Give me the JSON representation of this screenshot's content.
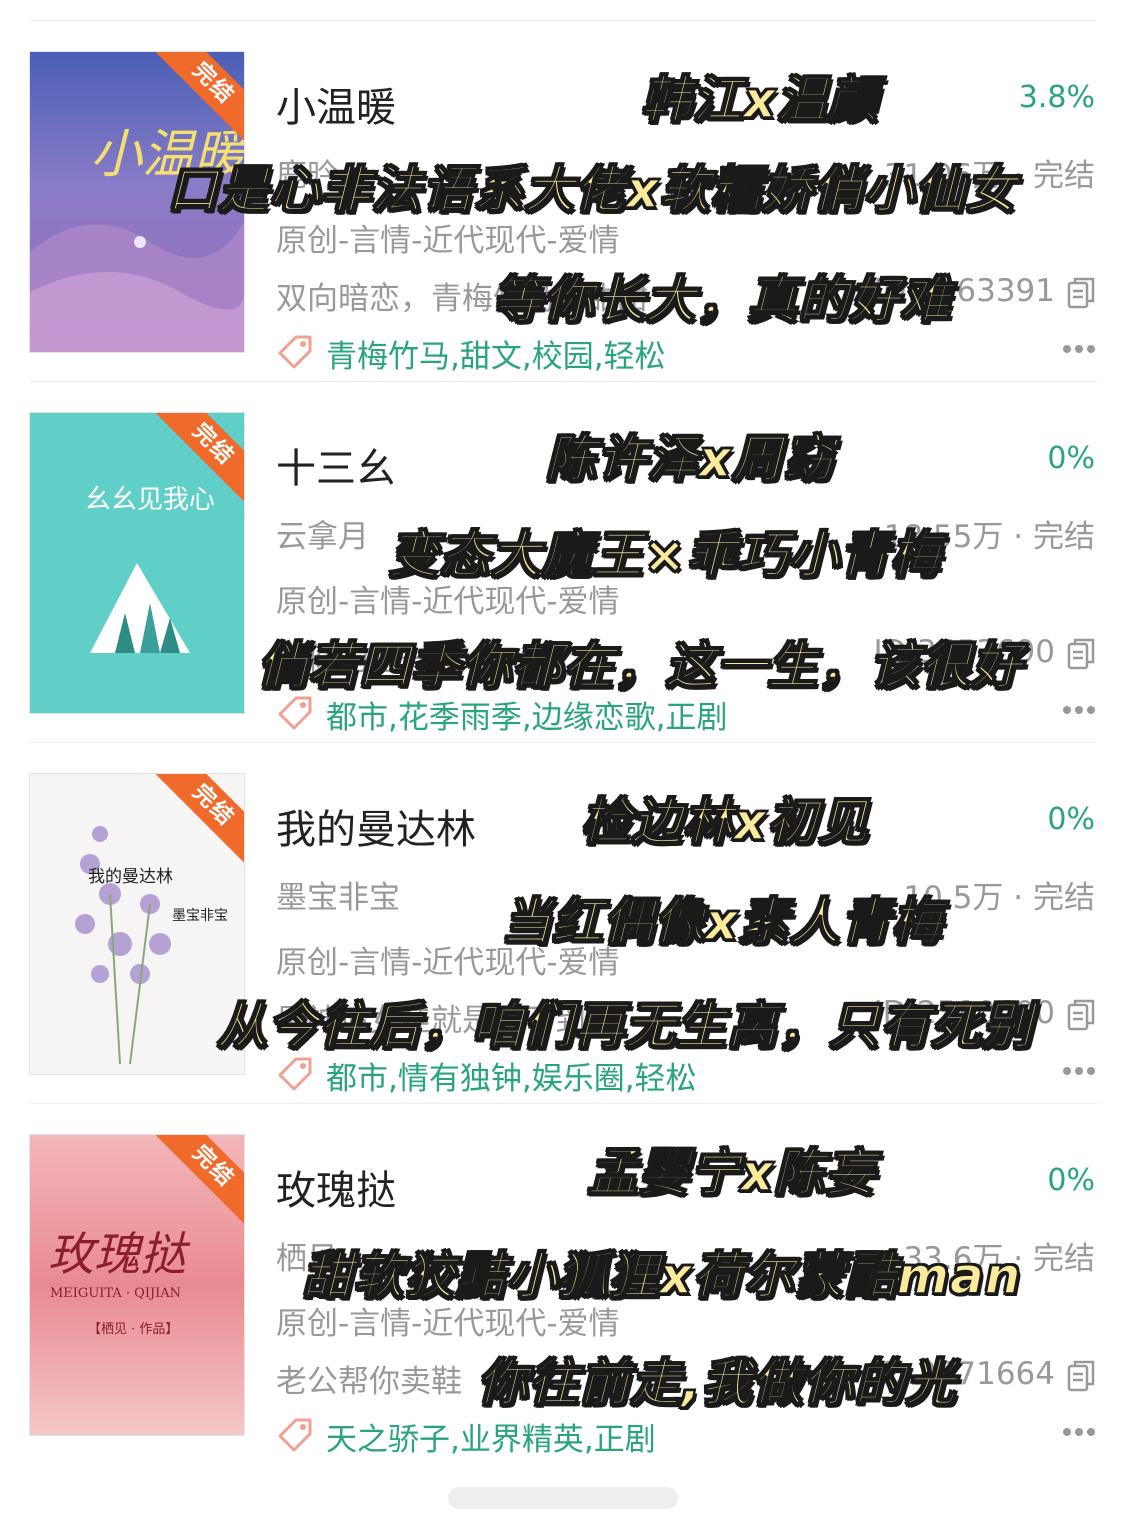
{
  "books": [
    {
      "title": "小温暖",
      "author": "鹿昑",
      "progress": "3.8%",
      "stats": "31.06万 · 完结",
      "genre": "原创-言情-近代现代-爱情",
      "desc": "双向暗恋，青梅竹马甜甜甜",
      "id": "ID:5463391",
      "tags": "青梅竹马,甜文,校园,轻松",
      "badge": "完结",
      "cover_title": "小温暖",
      "overlay": {
        "pair": "韩江x温颜",
        "tagline": "口是心非法语系大佬x软糯娇俏小仙女",
        "quote": "等你长大，真的好难"
      }
    },
    {
      "title": "十三幺",
      "author": "云拿月",
      "progress": "0%",
      "stats": "18.55万 · 完结",
      "genre": "原创-言情-近代现代-爱情",
      "desc": "和你的这一生",
      "id": "ID:3553690",
      "tags": "都市,花季雨季,边缘恋歌,正剧",
      "badge": "完结",
      "cover_title": "幺幺见我心",
      "overlay": {
        "pair": "陈许泽x周窈",
        "tagline": "变态大魔王×乖巧小青梅",
        "quote": "倘若四季你都在，这一生，该很好"
      }
    },
    {
      "title": "我的曼达林",
      "author": "墨宝非宝",
      "progress": "0%",
      "stats": "10.5万 · 完结",
      "genre": "原创-言情-近代现代-爱情",
      "desc": "男神追女娃就是追不到",
      "id": "ID:2580690",
      "tags": "都市,情有独钟,娱乐圈,轻松",
      "badge": "完结",
      "cover_title": "我的曼达林",
      "cover_author": "墨宝非宝",
      "overlay": {
        "pair": "检边林x初见",
        "tagline": "当红偶像x素人青梅",
        "quote": "从今往后，咱们再无生离，只有死别"
      }
    },
    {
      "title": "玫瑰挞",
      "author": "栖见",
      "progress": "0%",
      "stats": "33.6万 · 完结",
      "genre": "原创-言情-近代现代-爱情",
      "desc": "老公帮你卖鞋",
      "id": "ID:3671664",
      "tags": "天之骄子,业界精英,正剧",
      "badge": "完结",
      "cover_title": "玫瑰挞",
      "cover_sub": "MEIGUITA · QIJIAN",
      "cover_author": "【栖见 · 作品】",
      "overlay": {
        "pair": "孟婴宁x陈妄",
        "tagline": "甜软狡黠小狐狸x荷尔蒙酷man",
        "quote": "你往前走,我做你的光"
      }
    }
  ],
  "colors": {
    "accent": "#2aa47f",
    "badge": "#f06a2b",
    "overlay_fill": "#fbea9c"
  }
}
